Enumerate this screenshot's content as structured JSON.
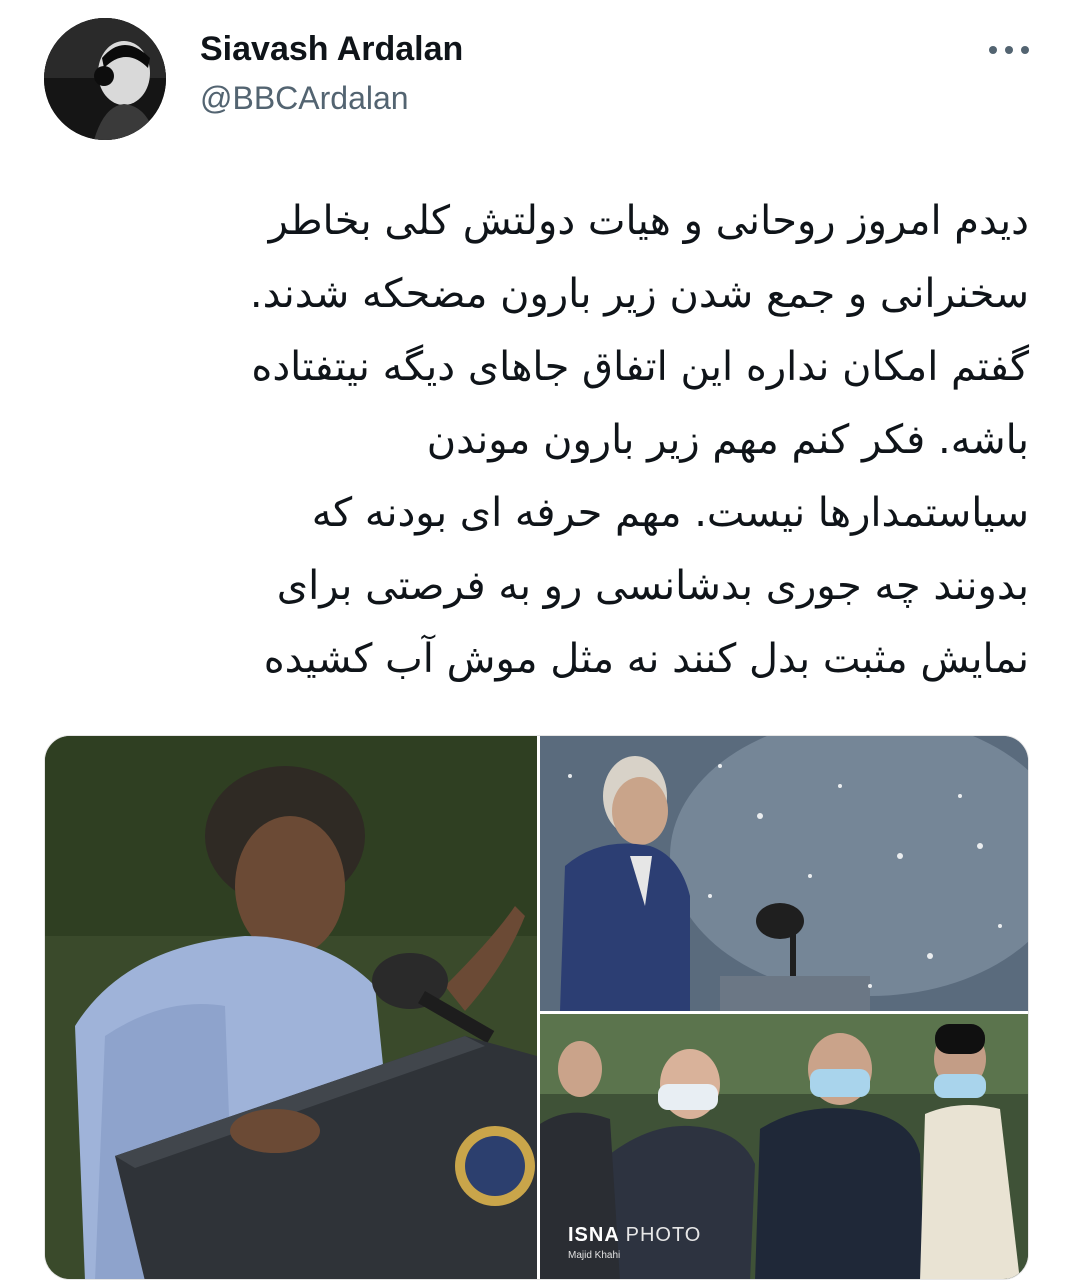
{
  "user": {
    "display_name": "Siavash Ardalan",
    "handle": "@BBCArdalan"
  },
  "tweet": {
    "lines": [
      "دیدم امروز روحانی و هیات دولتش کلی بخاطر",
      "سخنرانی و جمع شدن زیر بارون مضحکه شدند.",
      "گفتم امکان نداره این اتفاق جاهای دیگه نیتفتاده",
      "باشه. فکر کنم مهم زیر بارون موندن",
      "سیاستمدارها نیست. مهم حرفه ای بودنه که",
      "بدونند چه جوری بدشانسی رو به فرصتی برای",
      "نمایش مثبت بدل کنند نه مثل موش آب کشیده"
    ]
  },
  "media": {
    "watermark": "ISNA",
    "watermark_suffix": "PHOTO",
    "credit": "Majid Khahi"
  },
  "icons": {
    "more": "more-horizontal-icon"
  },
  "colors": {
    "text": "#0f1419",
    "secondary": "#536471",
    "background": "#ffffff"
  }
}
